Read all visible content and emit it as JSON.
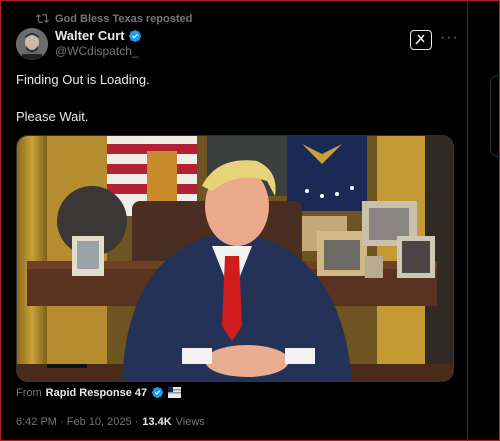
{
  "repost": {
    "label": "God Bless Texas reposted"
  },
  "author": {
    "name": "Walter Curt",
    "handle": "@WCdispatch_"
  },
  "post": {
    "line1": "Finding Out is Loading.",
    "line2": "Please Wait."
  },
  "source": {
    "prefix": "From",
    "name": "Rapid Response 47"
  },
  "meta": {
    "time": "6:42 PM · Feb 10, 2025 ·",
    "views_count": "13.4K",
    "views_label": "Views"
  },
  "icons": [
    "repost-icon",
    "verified-icon",
    "grok-icon",
    "more-icon",
    "flag-icon"
  ],
  "colors": {
    "background": "#000000",
    "text": "#e7e9ea",
    "muted": "#71767b",
    "verified": "#1d9bf0"
  }
}
